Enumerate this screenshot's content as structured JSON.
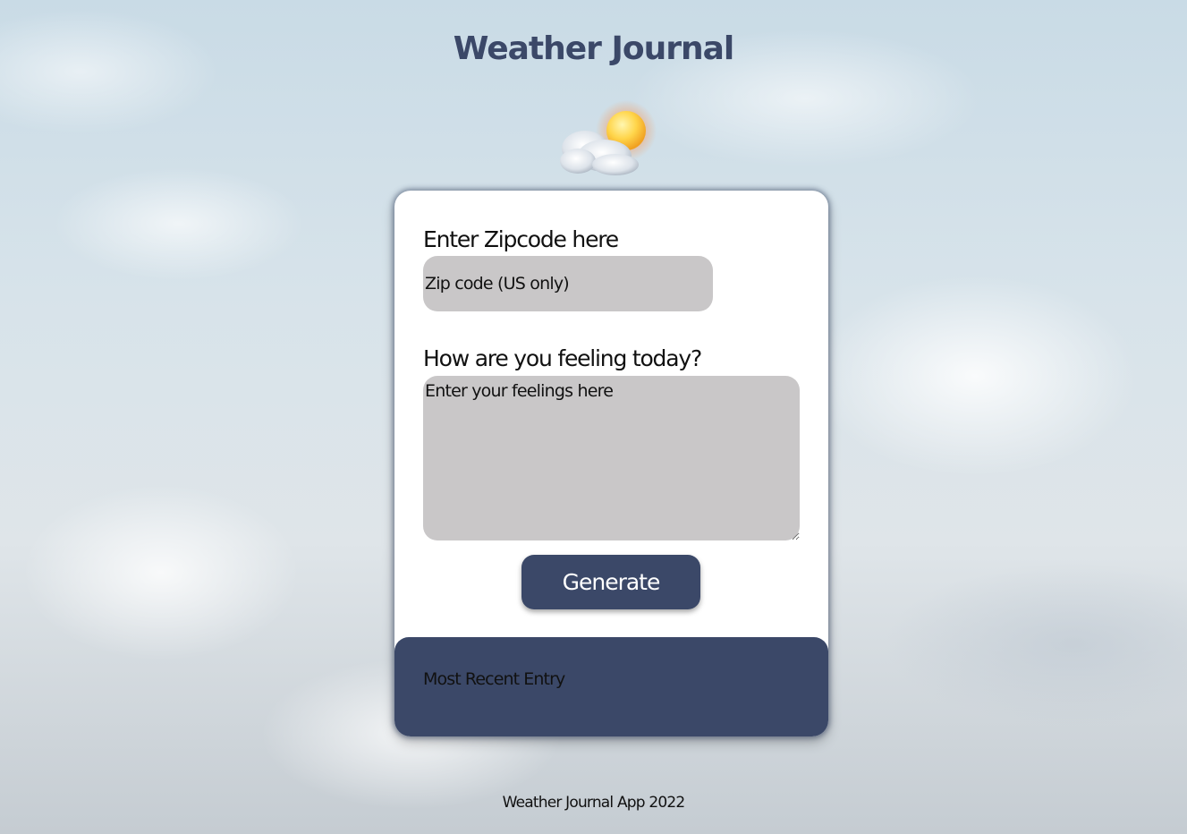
{
  "header": {
    "title": "Weather Journal",
    "icon": "sun-behind-cloud-icon"
  },
  "form": {
    "zip_label": "Enter Zipcode here",
    "zip_value": "",
    "zip_placeholder": "Zip code (US only)",
    "feelings_label": "How are you feeling today?",
    "feelings_value": "",
    "feelings_placeholder": "Enter your feelings here",
    "generate_label": "Generate"
  },
  "entry": {
    "title": "Most Recent Entry"
  },
  "footer": {
    "text": "Weather Journal App 2022"
  },
  "colors": {
    "accent": "#3b4868",
    "input_background": "#c9c7c8",
    "card_background": "#ffffff"
  }
}
